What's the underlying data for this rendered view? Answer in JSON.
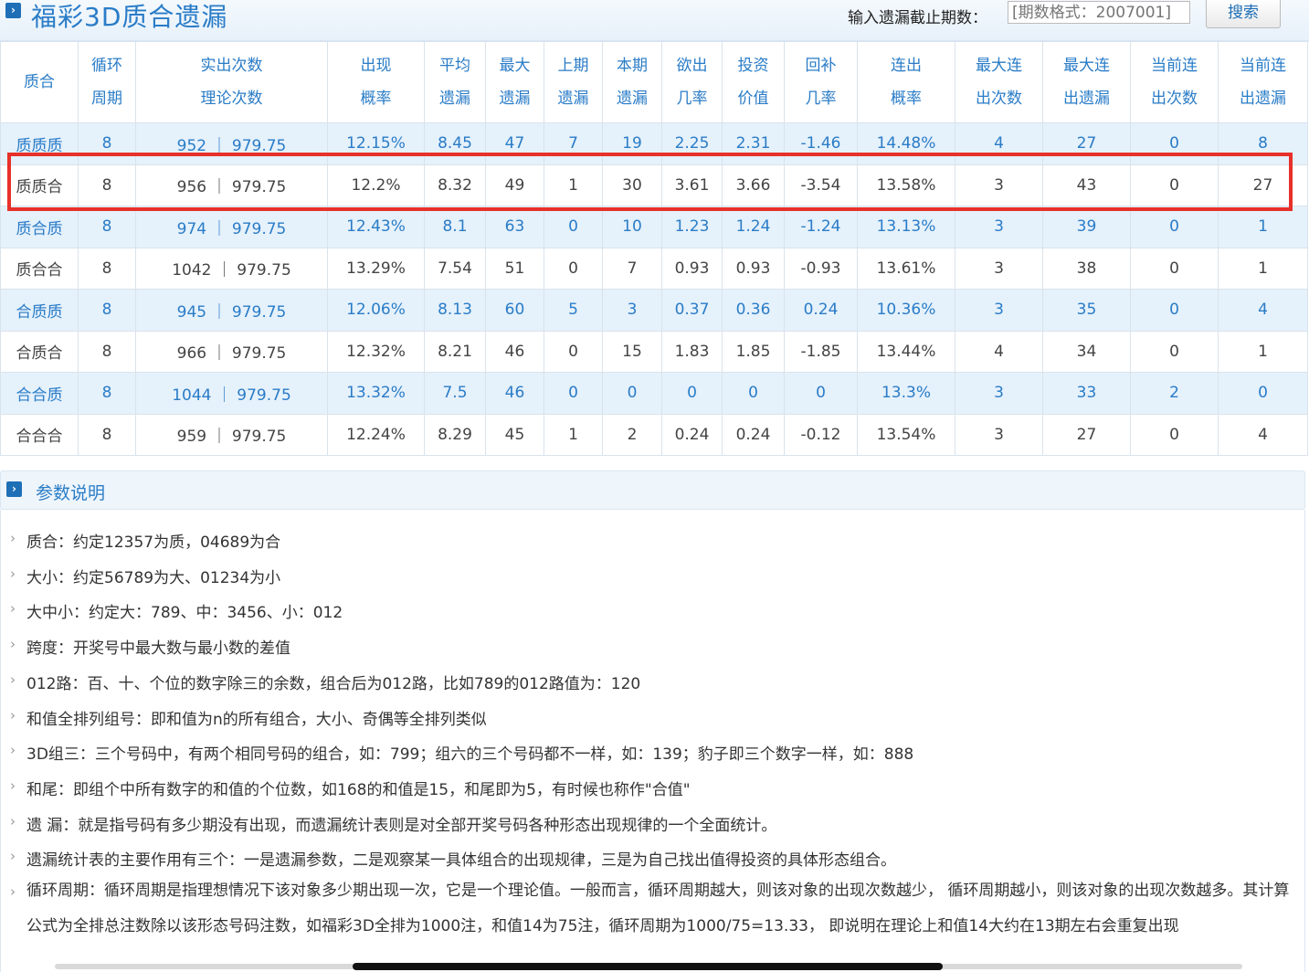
{
  "header": {
    "title": "福彩3D质合遗漏",
    "search_label": "输入遗漏截止期数：",
    "search_placeholder": "[期数格式：2007001]",
    "search_button": "搜索"
  },
  "table": {
    "columns": [
      {
        "l1": "质合",
        "l2": ""
      },
      {
        "l1": "循环",
        "l2": "周期"
      },
      {
        "l1": "实出次数",
        "l2": "理论次数"
      },
      {
        "l1": "出现",
        "l2": "概率"
      },
      {
        "l1": "平均",
        "l2": "遗漏"
      },
      {
        "l1": "最大",
        "l2": "遗漏"
      },
      {
        "l1": "上期",
        "l2": "遗漏"
      },
      {
        "l1": "本期",
        "l2": "遗漏"
      },
      {
        "l1": "欲出",
        "l2": "几率"
      },
      {
        "l1": "投资",
        "l2": "价值"
      },
      {
        "l1": "回补",
        "l2": "几率"
      },
      {
        "l1": "连出",
        "l2": "概率"
      },
      {
        "l1": "最大连",
        "l2": "出次数"
      },
      {
        "l1": "最大连",
        "l2": "出遗漏"
      },
      {
        "l1": "当前连",
        "l2": "出次数"
      },
      {
        "l1": "当前连",
        "l2": "出遗漏"
      }
    ],
    "rows": [
      [
        "质质质",
        "8",
        "952 ｜ 979.75",
        "12.15%",
        "8.45",
        "47",
        "7",
        "19",
        "2.25",
        "2.31",
        "-1.46",
        "14.48%",
        "4",
        "27",
        "0",
        "8"
      ],
      [
        "质质合",
        "8",
        "956 ｜ 979.75",
        "12.2%",
        "8.32",
        "49",
        "1",
        "30",
        "3.61",
        "3.66",
        "-3.54",
        "13.58%",
        "3",
        "43",
        "0",
        "27"
      ],
      [
        "质合质",
        "8",
        "974 ｜ 979.75",
        "12.43%",
        "8.1",
        "63",
        "0",
        "10",
        "1.23",
        "1.24",
        "-1.24",
        "13.13%",
        "3",
        "39",
        "0",
        "1"
      ],
      [
        "质合合",
        "8",
        "1042 ｜ 979.75",
        "13.29%",
        "7.54",
        "51",
        "0",
        "7",
        "0.93",
        "0.93",
        "-0.93",
        "13.61%",
        "3",
        "38",
        "0",
        "1"
      ],
      [
        "合质质",
        "8",
        "945 ｜ 979.75",
        "12.06%",
        "8.13",
        "60",
        "5",
        "3",
        "0.37",
        "0.36",
        "0.24",
        "10.36%",
        "3",
        "35",
        "0",
        "4"
      ],
      [
        "合质合",
        "8",
        "966 ｜ 979.75",
        "12.32%",
        "8.21",
        "46",
        "0",
        "15",
        "1.83",
        "1.85",
        "-1.85",
        "13.44%",
        "4",
        "34",
        "0",
        "1"
      ],
      [
        "合合质",
        "8",
        "1044 ｜ 979.75",
        "13.32%",
        "7.5",
        "46",
        "0",
        "0",
        "0",
        "0",
        "0",
        "13.3%",
        "3",
        "33",
        "2",
        "0"
      ],
      [
        "合合合",
        "8",
        "959 ｜ 979.75",
        "12.24%",
        "8.29",
        "45",
        "1",
        "2",
        "0.24",
        "0.24",
        "-0.12",
        "13.54%",
        "3",
        "27",
        "0",
        "4"
      ]
    ]
  },
  "params": {
    "title": "参数说明",
    "notes": [
      "质合：约定12357为质，04689为合",
      "大小：约定56789为大、01234为小",
      "大中小：约定大：789、中：3456、小：012",
      "跨度：开奖号中最大数与最小数的差值",
      "012路：百、十、个位的数字除三的余数，组合后为012路，比如789的012路值为：120",
      "和值全排列组号：即和值为n的所有组合，大小、奇偶等全排列类似",
      "3D组三：三个号码中，有两个相同号码的组合，如：799；组六的三个号码都不一样，如：139；豹子即三个数字一样，如：888",
      "和尾：即组个中所有数字的和值的个位数，如168的和值是15，和尾即为5，有时候也称作\"合值\"",
      "遗 漏：就是指号码有多少期没有出现，而遗漏统计表则是对全部开奖号码各种形态出现规律的一个全面统计。",
      "遗漏统计表的主要作用有三个：一是遗漏参数，二是观察某一具体组合的出现规律，三是为自己找出值得投资的具体形态组合。"
    ],
    "last_note": "循环周期：循环周期是指理想情况下该对象多少期出现一次，它是一个理论值。一般而言，循环周期越大，则该对象的出现次数越少， 循环周期越小，则该对象的出现次数越多。其计算公式为全排总注数除以该形态号码注数，如福彩3D全排为1000注，和值14为75注，循环周期为1000/75=13.33， 即说明在理论上和值14大约在13期左右会重复出现"
  },
  "icons": {
    "section": "play-square-icon",
    "chevron": "chevron-right-icon"
  },
  "colors": {
    "accent": "#2a7cc7",
    "highlight_border": "#e8302a",
    "row_stripe": "#e5f1fb"
  }
}
